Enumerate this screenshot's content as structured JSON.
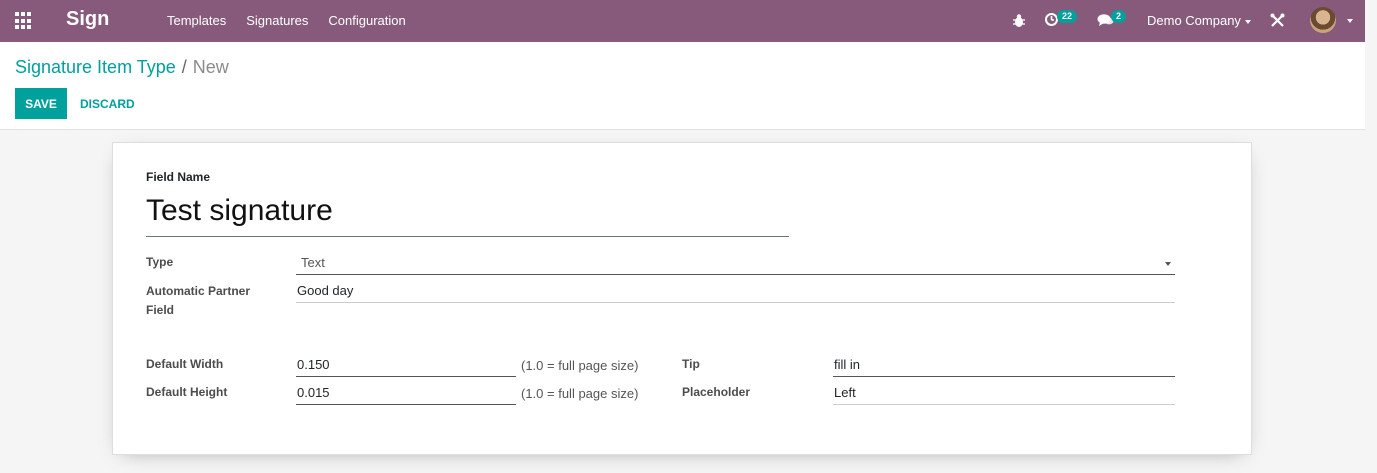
{
  "navbar": {
    "app_name": "Sign",
    "menu": [
      "Templates",
      "Signatures",
      "Configuration"
    ],
    "activity_count": "22",
    "messages_count": "2",
    "company": "Demo Company",
    "icons": [
      "apps-icon",
      "bug-icon",
      "clock-icon",
      "chat-icon",
      "tools-icon"
    ],
    "brand_color": "#875a7b"
  },
  "breadcrumb": {
    "parent": "Signature Item Type",
    "separator": "/",
    "current": "New"
  },
  "buttons": {
    "save": "SAVE",
    "discard": "DISCARD",
    "accent_color": "#00a09d"
  },
  "form": {
    "field_name_label": "Field Name",
    "field_name_value": "Test signature",
    "type_label": "Type",
    "type_value": "Text",
    "partner_label_line1": "Automatic Partner",
    "partner_label_line2": "Field",
    "partner_value": "Good day",
    "width_label": "Default Width",
    "width_value": "0.150",
    "width_hint": "(1.0 = full page size)",
    "height_label": "Default Height",
    "height_value": "0.015",
    "height_hint": "(1.0 = full page size)",
    "tip_label": "Tip",
    "tip_value": "fill in",
    "placeholder_label": "Placeholder",
    "placeholder_value": "Left"
  }
}
